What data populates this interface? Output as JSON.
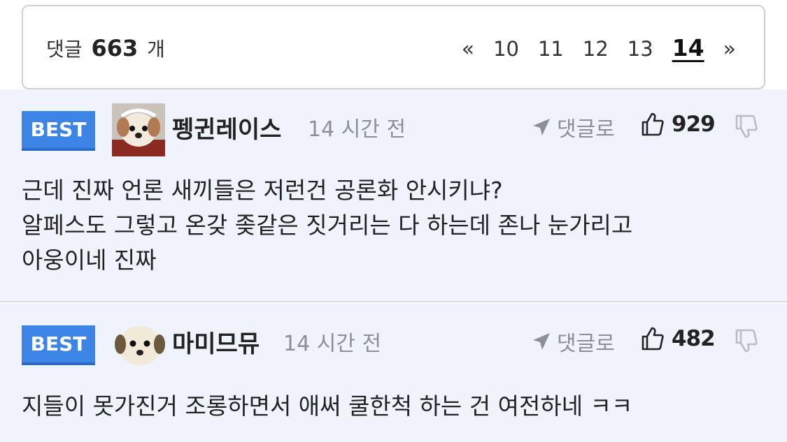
{
  "header": {
    "count_prefix": "댓글",
    "count_value": "663",
    "count_suffix": "개",
    "pager": {
      "prev": "«",
      "pages": [
        "10",
        "11",
        "12",
        "13",
        "14"
      ],
      "current": "14",
      "next": "»"
    }
  },
  "comments": [
    {
      "badge": "BEST",
      "username": "펭귄레이스",
      "time": "14 시간 전",
      "reply_label": "댓글로",
      "likes": "929",
      "lines": [
        "근데 진짜 언론 새끼들은 저런건 공론화 안시키냐?",
        "알페스도 그렇고 온갖 좆같은 짓거리는 다 하는데 존나 눈가리고",
        "아웅이네 진짜"
      ]
    },
    {
      "badge": "BEST",
      "username": "마미므뮤",
      "time": "14 시간 전",
      "reply_label": "댓글로",
      "likes": "482",
      "lines": [
        "지들이 못가진거 조롱하면서 애써 쿨한척 하는 건 여전하네 ㅋㅋ"
      ]
    }
  ],
  "colors": {
    "best_badge": "#3c84e6",
    "comment_bg": "#eef3fc",
    "muted_text": "#8a8f98"
  }
}
